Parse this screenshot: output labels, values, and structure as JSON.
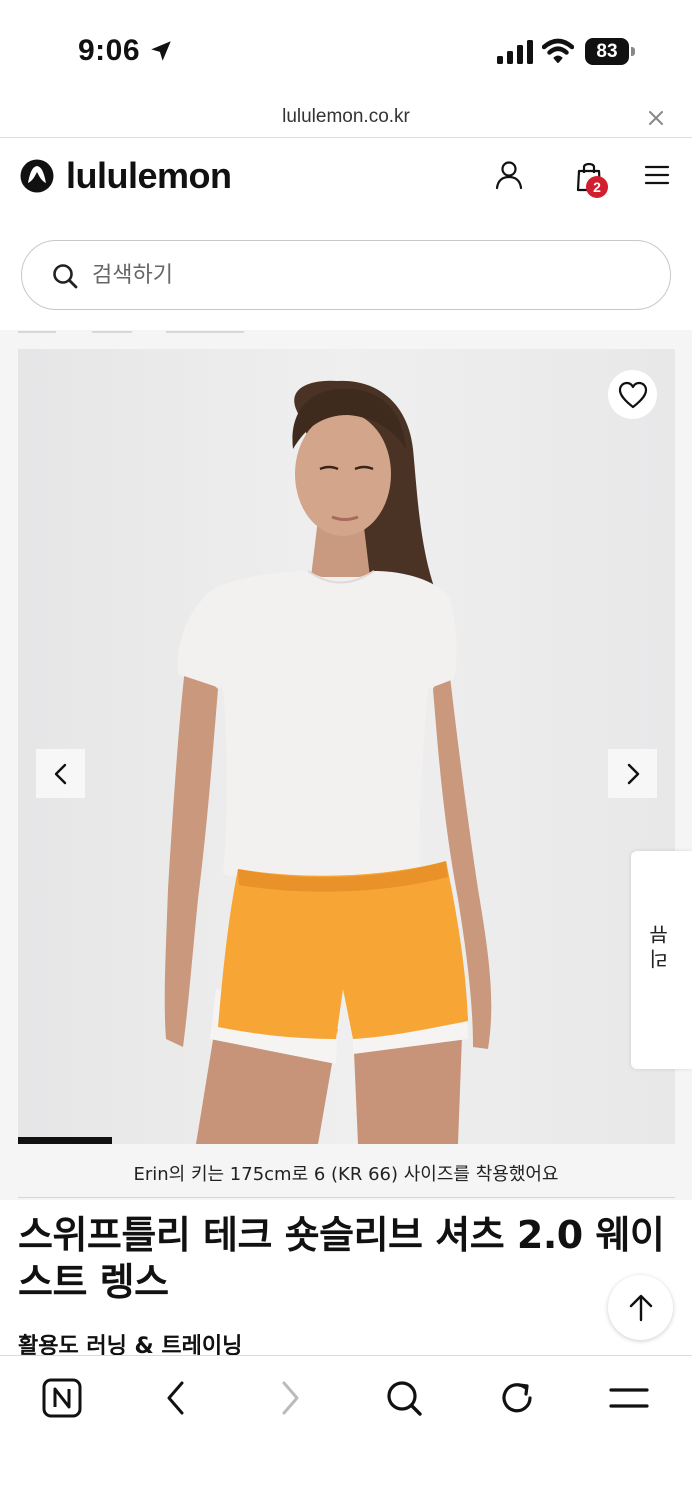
{
  "status_bar": {
    "time": "9:06",
    "battery": "83"
  },
  "url_bar": {
    "url": "lululemon.co.kr"
  },
  "header": {
    "brand": "lululemon",
    "cart_count": "2"
  },
  "search": {
    "placeholder": "검색하기"
  },
  "gallery": {
    "image_index": 1,
    "image_count": 7,
    "review_tab_label": "리뷰"
  },
  "product": {
    "model_caption": "Erin의 키는 175cm로 6 (KR 66) 사이즈를 착용했어요",
    "title": "스위프틀리 테크 숏슬리브 셔츠 2.0 웨이스트 렝스",
    "activity": "활용도 러닝 & 트레이닝"
  },
  "colors": {
    "badge": "#d21f2f",
    "shorts": "#f7a534",
    "shirt": "#f3f0f0"
  },
  "icons": {
    "location": "location-arrow-icon",
    "signal": "cellular-signal-icon",
    "wifi": "wifi-icon",
    "close": "close-icon",
    "account": "user-icon",
    "cart": "shopping-bag-icon",
    "menu": "hamburger-menu-icon",
    "search": "search-icon",
    "wishlist": "heart-icon",
    "prev": "chevron-left-icon",
    "next": "chevron-right-icon",
    "scroll_top": "arrow-up-icon",
    "naver": "naver-n-icon",
    "back": "back-icon",
    "forward": "forward-icon",
    "browser_search": "search-icon",
    "refresh": "refresh-icon",
    "browser_menu": "menu-icon"
  }
}
